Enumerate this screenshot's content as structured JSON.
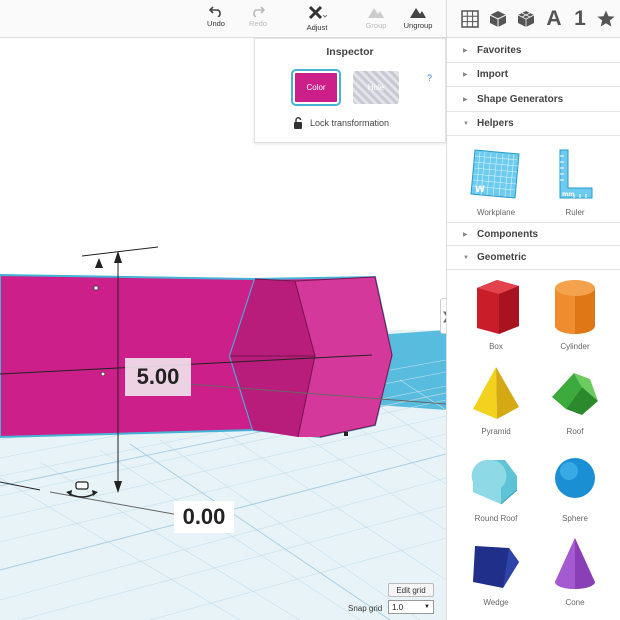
{
  "toolbar": {
    "undo": "Undo",
    "redo": "Redo",
    "adjust": "Adjust",
    "group": "Group",
    "ungroup": "Ungroup"
  },
  "right_tabs": {
    "icons": [
      "workplane-grid-icon",
      "cube-icon",
      "cubes-icon",
      "text-icon",
      "number-icon",
      "star-icon"
    ],
    "text_tab": "A",
    "number_tab": "1"
  },
  "inspector": {
    "title": "Inspector",
    "color_label": "Color",
    "hole_label": "Hole",
    "help": "?",
    "lock_label": "Lock transformation",
    "color_value": "#cc1f8a"
  },
  "panel": {
    "sections": {
      "favorites": "Favorites",
      "import": "Import",
      "shape_generators": "Shape Generators",
      "helpers": "Helpers",
      "components": "Components",
      "geometric": "Geometric"
    },
    "helpers": [
      "Workplane",
      "Ruler"
    ],
    "geometric": [
      "Box",
      "Cylinder",
      "Pyramid",
      "Roof",
      "Round Roof",
      "Sphere",
      "Wedge",
      "Cone"
    ]
  },
  "viewport": {
    "height_dimension": "5.00",
    "elevation_dimension": "0.00",
    "edit_grid": "Edit grid",
    "snap_label": "Snap grid",
    "snap_value": "1.0",
    "accent": "#45b3d6",
    "shape_color": "#cc1f8a"
  }
}
